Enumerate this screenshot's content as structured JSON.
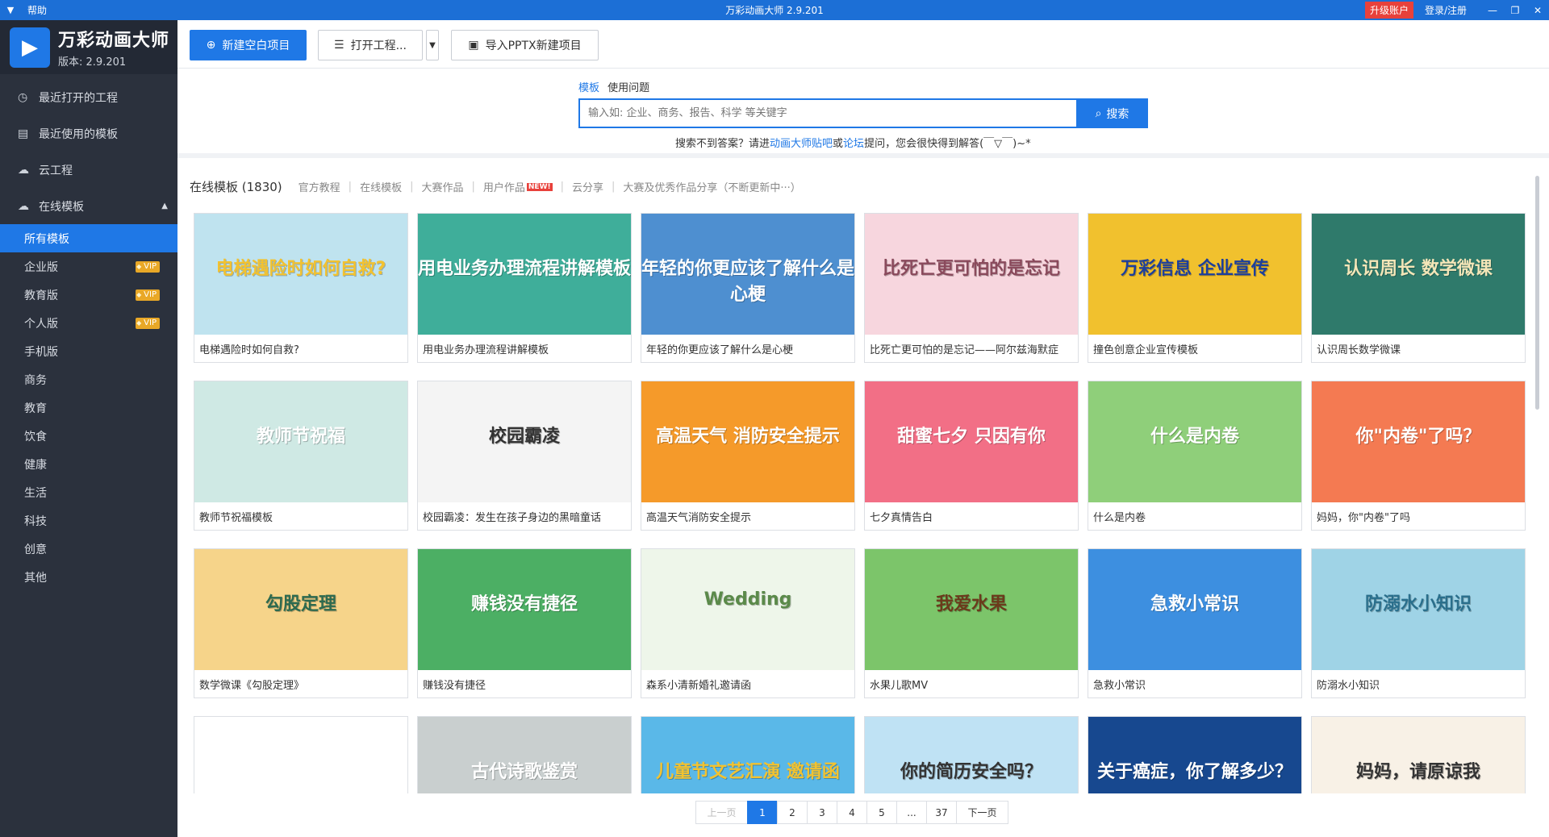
{
  "titlebar": {
    "help": "帮助",
    "title": "万彩动画大师 2.9.201",
    "upgrade": "升级账户",
    "login": "登录/注册"
  },
  "brand": {
    "name": "万彩动画大师",
    "version": "版本: 2.9.201"
  },
  "sidebar": {
    "items": [
      {
        "label": "最近打开的工程",
        "icon": "clock-icon"
      },
      {
        "label": "最近使用的模板",
        "icon": "template-icon"
      },
      {
        "label": "云工程",
        "icon": "cloud-icon"
      },
      {
        "label": "在线模板",
        "icon": "cloud-icon"
      }
    ],
    "subitems": [
      {
        "label": "所有模板",
        "active": true
      },
      {
        "label": "企业版",
        "vip": "VIP"
      },
      {
        "label": "教育版",
        "vip": "VIP"
      },
      {
        "label": "个人版",
        "vip": "VIP"
      },
      {
        "label": "手机版"
      },
      {
        "label": "商务"
      },
      {
        "label": "教育"
      },
      {
        "label": "饮食"
      },
      {
        "label": "健康"
      },
      {
        "label": "生活"
      },
      {
        "label": "科技"
      },
      {
        "label": "创意"
      },
      {
        "label": "其他"
      }
    ]
  },
  "toolbar": {
    "new_blank": "新建空白项目",
    "open_project": "打开工程...",
    "import_pptx": "导入PPTX新建项目"
  },
  "search": {
    "tab_template": "模板",
    "tab_faq": "使用问题",
    "placeholder": "输入如: 企业、商务、报告、科学 等关键字",
    "button": "搜索",
    "hint_prefix": "搜索不到答案？请进",
    "hint_link1": "动画大师贴吧",
    "hint_or": "或",
    "hint_link2": "论坛",
    "hint_suffix": "提问，您会很快得到解答(￣▽￣)~*"
  },
  "content_tabs": {
    "active": "在线模板 (1830)",
    "tabs": [
      "官方教程",
      "在线模板",
      "大赛作品",
      "用户作品",
      "云分享",
      "大赛及优秀作品分享（不断更新中···）"
    ],
    "new_badge": "NEW!"
  },
  "cards": [
    {
      "caption": "电梯遇险时如何自救?",
      "thumb_text": "电梯遇险时如何自救?",
      "bg": "#bfe3ef",
      "fg": "#f2c230"
    },
    {
      "caption": "用电业务办理流程讲解模板",
      "thumb_text": "用电业务办理流程讲解模板",
      "bg": "#3fae9a",
      "fg": "#ffffff"
    },
    {
      "caption": "年轻的你更应该了解什么是心梗",
      "thumb_text": "年轻的你更应该了解什么是心梗",
      "bg": "#4e8fd0",
      "fg": "#ffffff"
    },
    {
      "caption": "比死亡更可怕的是忘记——阿尔兹海默症",
      "thumb_text": "比死亡更可怕的是忘记",
      "bg": "#f7d6de",
      "fg": "#8a4a5c"
    },
    {
      "caption": "撞色创意企业宣传模板",
      "thumb_text": "万彩信息 企业宣传",
      "bg": "#f1c12e",
      "fg": "#1d3f9c"
    },
    {
      "caption": "认识周长数学微课",
      "thumb_text": "认识周长 数学微课",
      "bg": "#2f7a6b",
      "fg": "#f4e6b8"
    },
    {
      "caption": "教师节祝福模板",
      "thumb_text": "教师节祝福",
      "bg": "#cfe9e4",
      "fg": "#ffffff"
    },
    {
      "caption": "校园霸凌：发生在孩子身边的黑暗童话",
      "thumb_text": "校园霸凌",
      "bg": "#f4f4f4",
      "fg": "#333333"
    },
    {
      "caption": "高温天气消防安全提示",
      "thumb_text": "高温天气 消防安全提示",
      "bg": "#f59a2a",
      "fg": "#ffffff"
    },
    {
      "caption": "七夕真情告白",
      "thumb_text": "甜蜜七夕 只因有你",
      "bg": "#f26f86",
      "fg": "#ffffff"
    },
    {
      "caption": "什么是内卷",
      "thumb_text": "什么是内卷",
      "bg": "#8fcf7a",
      "fg": "#ffffff"
    },
    {
      "caption": "妈妈，你\"内卷\"了吗",
      "thumb_text": "你\"内卷\"了吗？",
      "bg": "#f47a52",
      "fg": "#ffffff"
    },
    {
      "caption": "数学微课《勾股定理》",
      "thumb_text": "勾股定理",
      "bg": "#f6d48a",
      "fg": "#2d6a4f"
    },
    {
      "caption": "赚钱没有捷径",
      "thumb_text": "赚钱没有捷径",
      "bg": "#4caf64",
      "fg": "#ffffff"
    },
    {
      "caption": "森系小清新婚礼邀请函",
      "thumb_text": "Wedding",
      "bg": "#eef6ea",
      "fg": "#5b8a4a"
    },
    {
      "caption": "水果儿歌MV",
      "thumb_text": "我爱水果",
      "bg": "#7cc56a",
      "fg": "#6b3a1b"
    },
    {
      "caption": "急救小常识",
      "thumb_text": "急救小常识",
      "bg": "#3d8fe0",
      "fg": "#ffffff"
    },
    {
      "caption": "防溺水小知识",
      "thumb_text": "防溺水小知识",
      "bg": "#9fd3e6",
      "fg": "#2a6f8c"
    },
    {
      "caption": "",
      "thumb_text": "",
      "bg": "#ffffff",
      "fg": "#333333"
    },
    {
      "caption": "",
      "thumb_text": "古代诗歌鉴赏",
      "bg": "#c9cfcf",
      "fg": "#ffffff"
    },
    {
      "caption": "",
      "thumb_text": "儿童节文艺汇演 邀请函",
      "bg": "#5ab8e8",
      "fg": "#f2c230"
    },
    {
      "caption": "",
      "thumb_text": "你的简历安全吗？",
      "bg": "#bfe2f4",
      "fg": "#333333"
    },
    {
      "caption": "",
      "thumb_text": "关于癌症，你了解多少？",
      "bg": "#17488f",
      "fg": "#ffffff"
    },
    {
      "caption": "",
      "thumb_text": "妈妈，请原谅我",
      "bg": "#f8f1e6",
      "fg": "#333333"
    }
  ],
  "pagination": {
    "prev": "上一页",
    "pages": [
      "1",
      "2",
      "3",
      "4",
      "5",
      "...",
      "37"
    ],
    "next": "下一页",
    "current": "1"
  }
}
